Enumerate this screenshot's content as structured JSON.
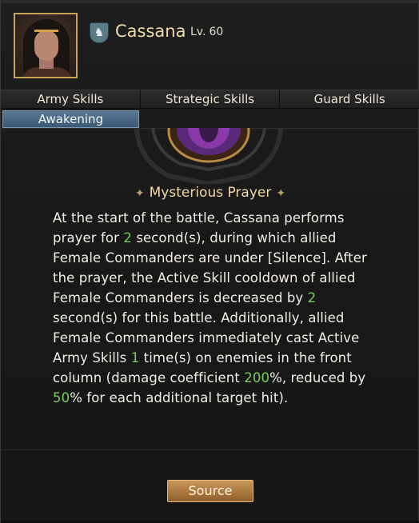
{
  "commander": {
    "name": "Cassana",
    "level_label": "Lv.",
    "level_value": "60"
  },
  "tabs": [
    {
      "label": "Army Skills"
    },
    {
      "label": "Strategic Skills"
    },
    {
      "label": "Guard Skills"
    }
  ],
  "subtab": {
    "label": "Awakening"
  },
  "skill": {
    "title": "Mysterious Prayer",
    "desc": {
      "p1": "At the start of the battle, Cassana performs prayer for ",
      "v1": "2",
      "p2": " second(s), during which allied Female Commanders are under [Silence]. After the prayer, the Active Skill cooldown of allied Female Commanders is decreased by ",
      "v2": "2",
      "p3": " second(s) for this battle. Additionally, allied Female Commanders immediately cast Active Army Skills ",
      "v3": "1",
      "p4": " time(s) on enemies in the front column (damage coefficient ",
      "v4": "200",
      "p5": "%, reduced by ",
      "v5": "50",
      "p6": "% for each additional target hit)."
    }
  },
  "buttons": {
    "source": "Source"
  },
  "colors": {
    "gold_name": "#f0d9a8",
    "highlight_green": "#76d05a",
    "tab_selected": "#4a6a86",
    "button_gold": "#b8864a"
  },
  "icons": {
    "faction": "horse-head-icon",
    "title_ornament": "sparkle-icon"
  }
}
